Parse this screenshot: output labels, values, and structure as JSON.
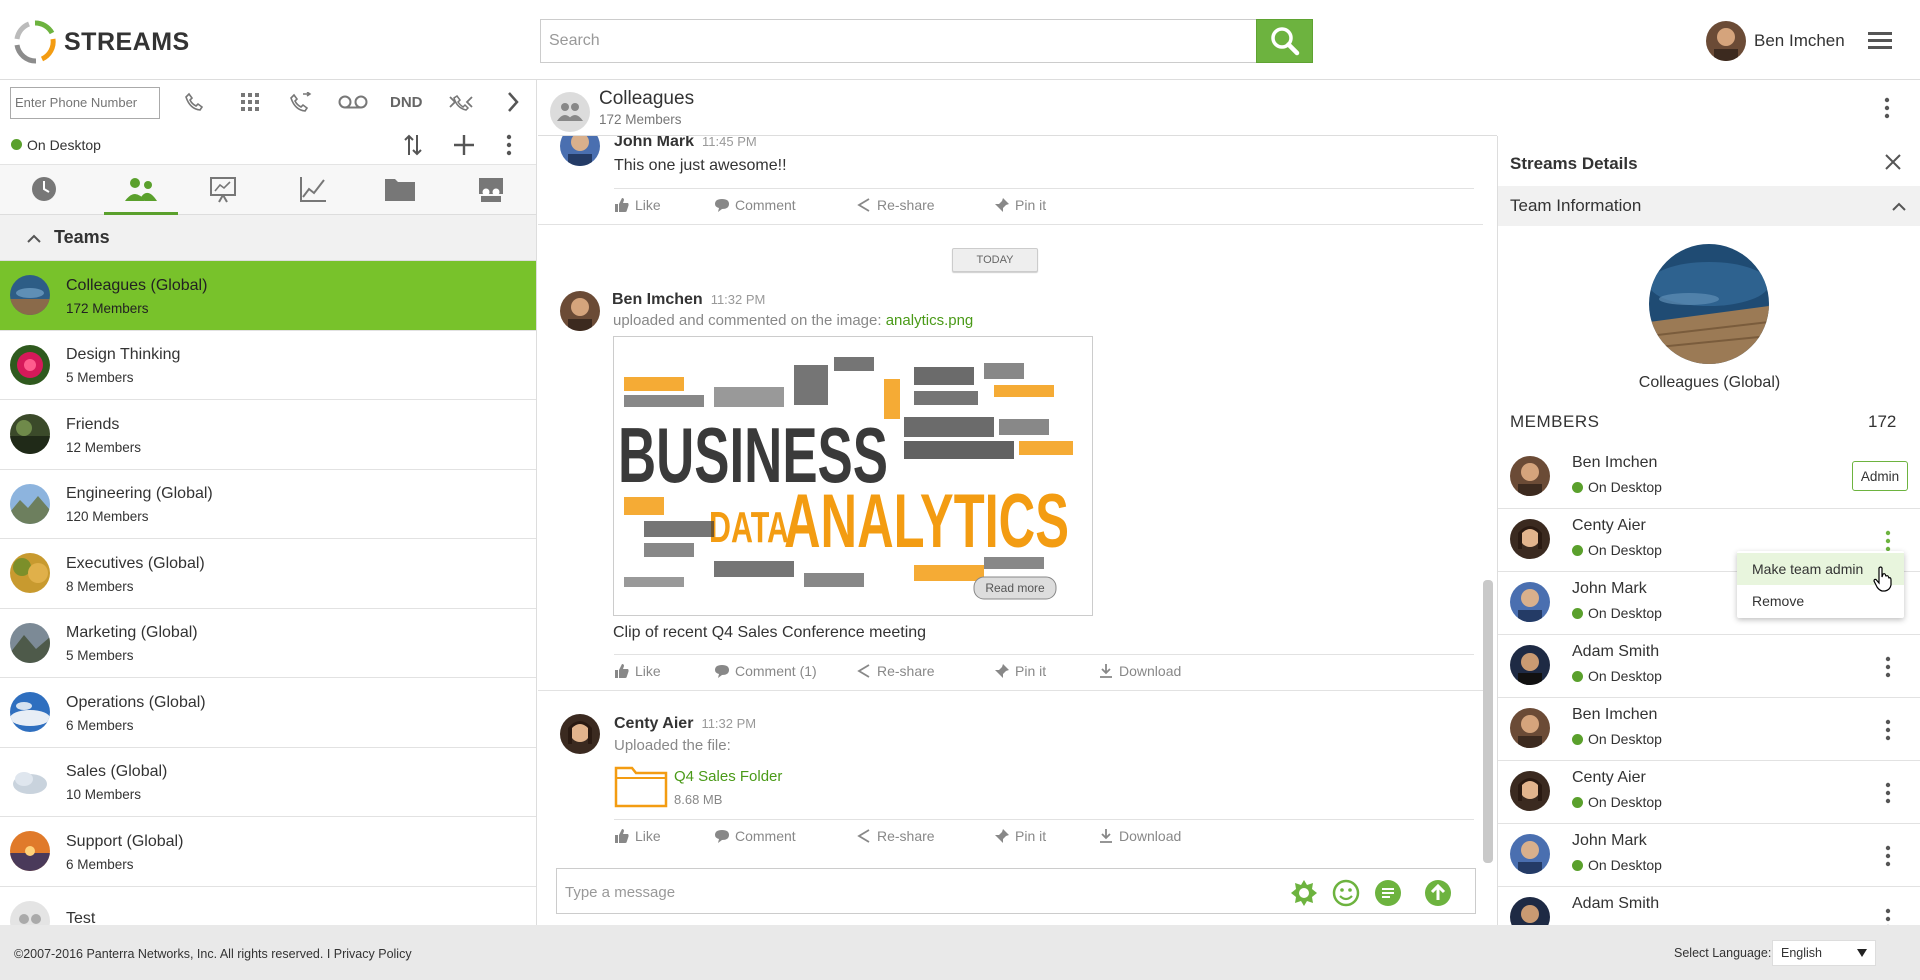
{
  "header": {
    "brand": "STREAMS",
    "search_placeholder": "Search",
    "user_name": "Ben Imchen"
  },
  "dialer": {
    "phone_placeholder": "Enter Phone Number",
    "dnd_label": "DND",
    "status": "On Desktop"
  },
  "left_tabs": [
    "history-icon",
    "teams-icon",
    "presentation-icon",
    "analytics-icon",
    "folder-icon",
    "meetings-icon"
  ],
  "teams_section": {
    "title": "Teams",
    "items": [
      {
        "name": "Colleagues (Global)",
        "count": "172 Members",
        "selected": true
      },
      {
        "name": "Design Thinking",
        "count": "5 Members"
      },
      {
        "name": "Friends",
        "count": "12 Members"
      },
      {
        "name": "Engineering (Global)",
        "count": "120 Members"
      },
      {
        "name": "Executives (Global)",
        "count": "8 Members"
      },
      {
        "name": "Marketing (Global)",
        "count": "5 Members"
      },
      {
        "name": "Operations (Global)",
        "count": "6 Members"
      },
      {
        "name": "Sales (Global)",
        "count": "10 Members"
      },
      {
        "name": "Support (Global)",
        "count": "6 Members"
      },
      {
        "name": "Test",
        "count": ""
      }
    ]
  },
  "channel": {
    "title": "Colleagues",
    "subtitle": "172 Members"
  },
  "feed": {
    "today_label": "TODAY",
    "posts": [
      {
        "author": "John Mark",
        "time": "11:45 PM",
        "text": "This one just awesome!!",
        "actions": [
          "Like",
          "Comment",
          "Re-share",
          "Pin it"
        ]
      },
      {
        "author": "Ben Imchen",
        "time": "11:32 PM",
        "text_prefix": "uploaded and commented on the image:",
        "link": "analytics.png",
        "caption": "Clip of recent Q4 Sales Conference meeting",
        "image_words": {
          "business": "BUSINESS",
          "analytics": "ANALYTICS",
          "data": "DATA",
          "read_more": "Read more"
        },
        "actions": [
          "Like",
          "Comment (1)",
          "Re-share",
          "Pin it",
          "Download"
        ]
      },
      {
        "author": "Centy Aier",
        "time": "11:32 PM",
        "text": "Uploaded the file:",
        "file_name": "Q4 Sales Folder",
        "file_size": "8.68 MB",
        "actions": [
          "Like",
          "Comment",
          "Re-share",
          "Pin it",
          "Download"
        ]
      }
    ]
  },
  "composer": {
    "placeholder": "Type a message"
  },
  "details": {
    "title": "Streams Details",
    "section_title": "Team Information",
    "team_name": "Colleagues (Global)",
    "members_label": "MEMBERS",
    "members_count": "172",
    "admin_label": "Admin",
    "members": [
      {
        "name": "Ben Imchen",
        "status": "On Desktop"
      },
      {
        "name": "Centy Aier",
        "status": "On Desktop"
      },
      {
        "name": "John Mark",
        "status": "On Desktop"
      },
      {
        "name": "Adam Smith",
        "status": "On Desktop"
      },
      {
        "name": "Ben Imchen",
        "status": "On Desktop"
      },
      {
        "name": "Centy Aier",
        "status": "On Desktop"
      },
      {
        "name": "John Mark",
        "status": "On Desktop"
      },
      {
        "name": "Adam Smith",
        "status": ""
      }
    ],
    "context_menu": [
      "Make team admin",
      "Remove"
    ]
  },
  "footer": {
    "copyright": "©2007-2016 Panterra Networks, Inc. All rights reserved. I Privacy Policy",
    "language_label": "Select Language:",
    "language_value": "English"
  },
  "colors": {
    "accent_green": "#78c22b",
    "button_green": "#6db33f",
    "link_green": "#4a9a18",
    "status_green": "#5aa02c",
    "word_orange": "#f39c12"
  }
}
